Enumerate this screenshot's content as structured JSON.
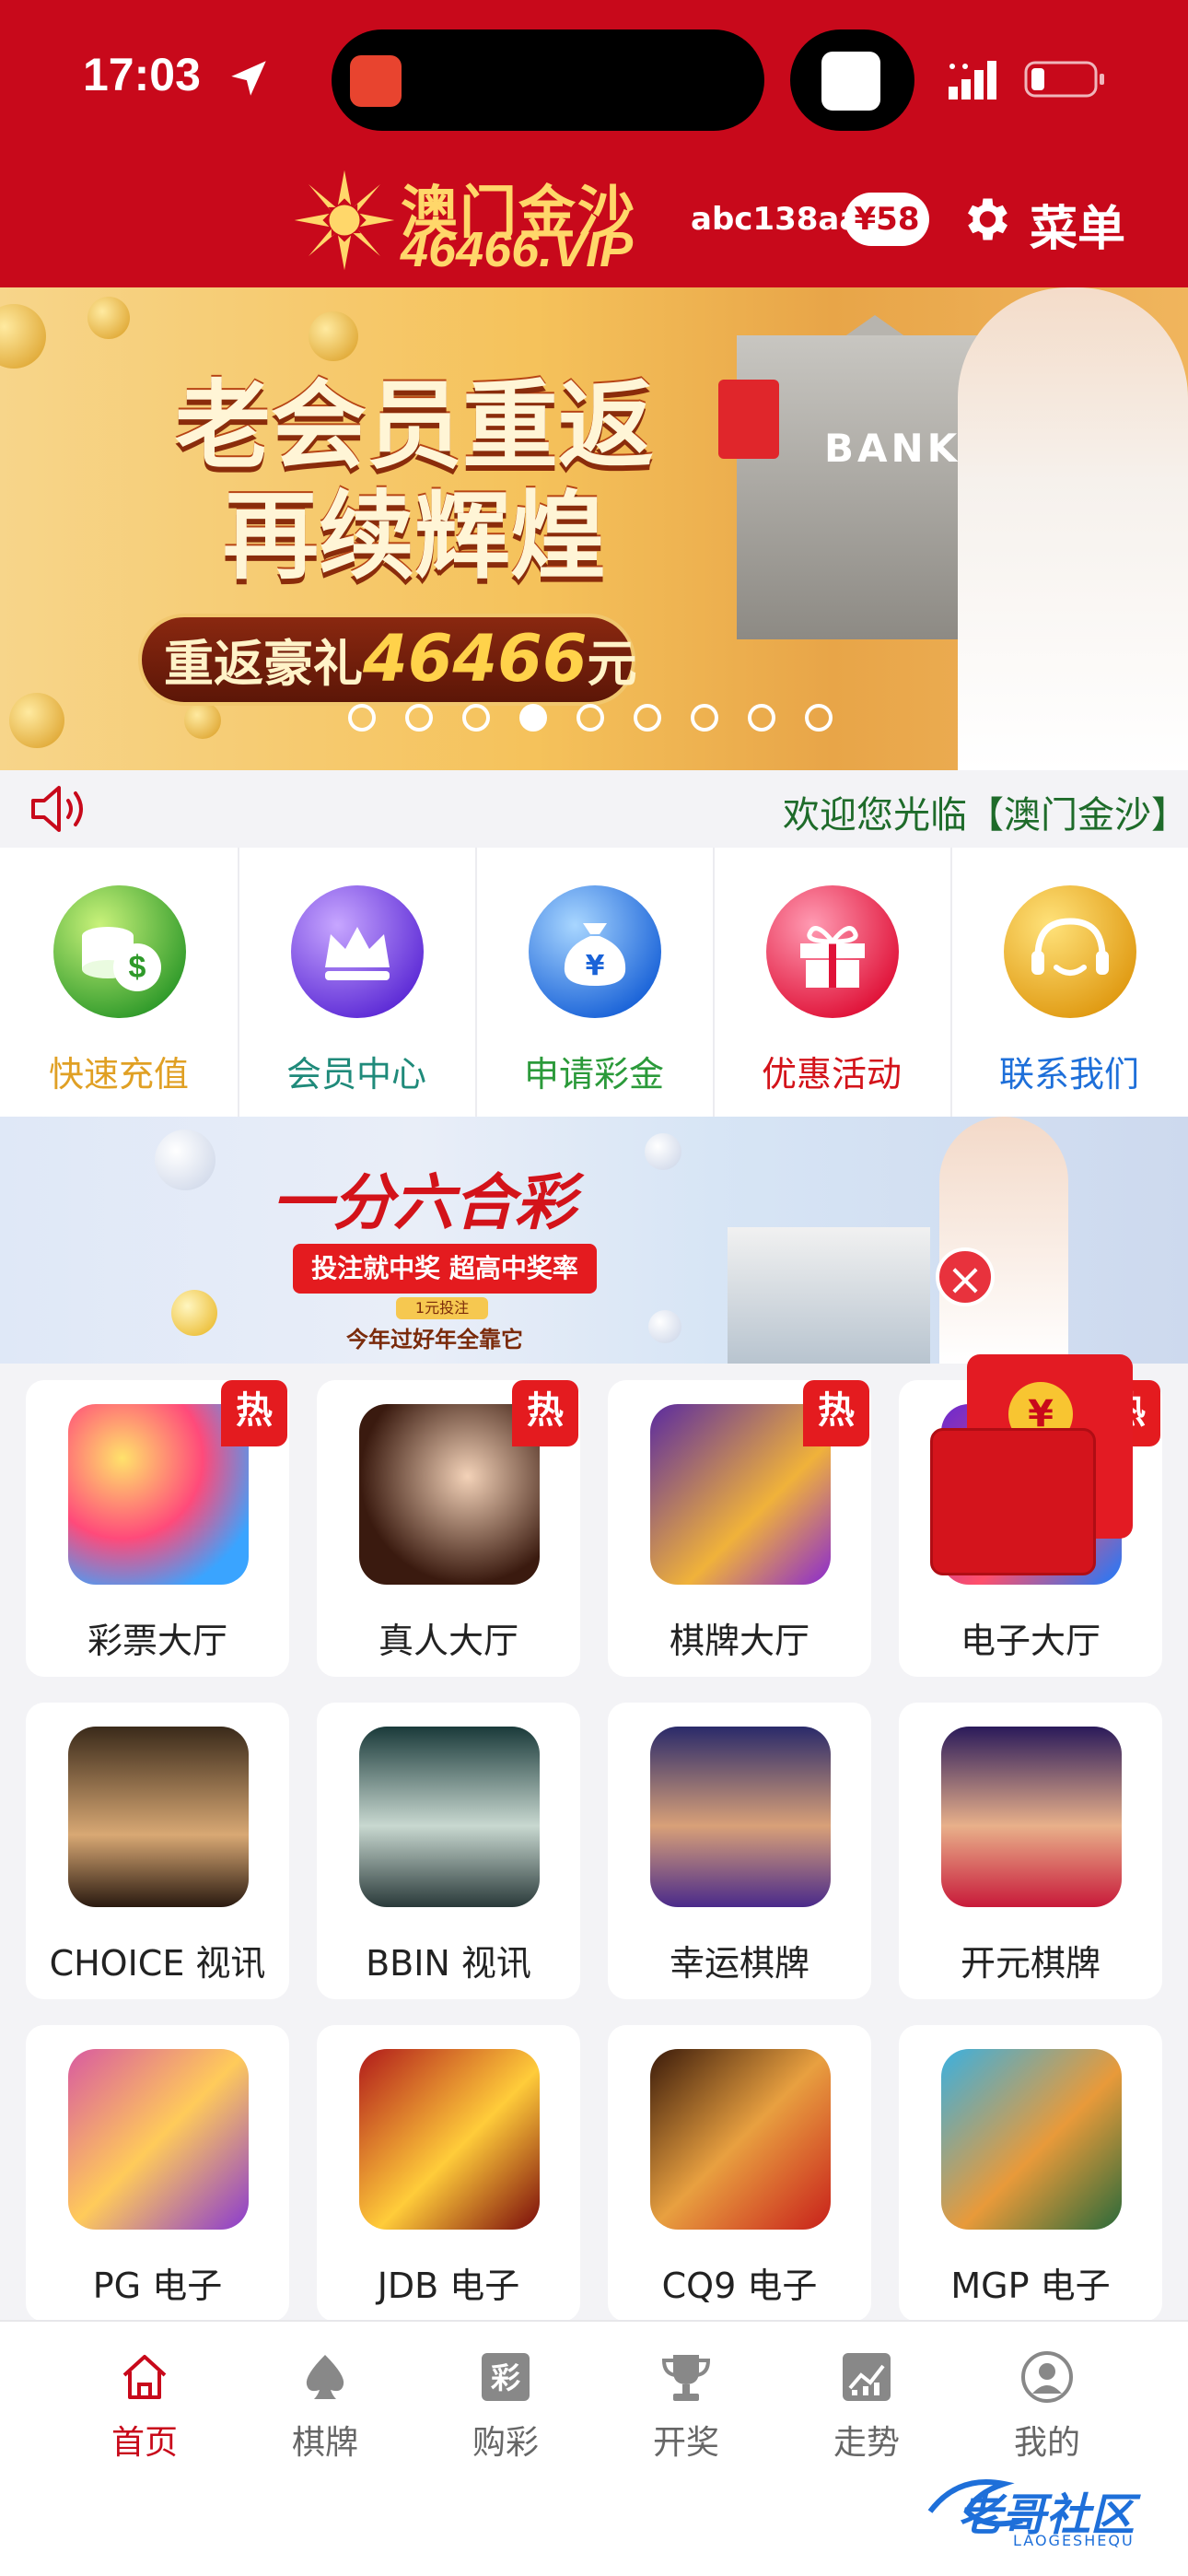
{
  "status_bar": {
    "time": "17:03"
  },
  "header": {
    "logo_cn": "澳门金沙",
    "logo_en": "46466.VIP",
    "username": "abc138aa",
    "balance": "¥58",
    "menu_label": "菜单",
    "color": "#c8091b"
  },
  "hero": {
    "title_line1": "老会员重返",
    "title_line2": "再续辉煌",
    "sub_prefix": "重返豪礼",
    "sub_number": "46466",
    "sub_suffix": "元",
    "bank_label": "BANK",
    "dot_count": 9,
    "active_dot": 3
  },
  "notice": {
    "text": "欢迎您光临【澳门金沙】"
  },
  "quick_actions": [
    {
      "label": "快速充值",
      "icon": "money-stack-icon",
      "color": "#e0a024"
    },
    {
      "label": "会员中心",
      "icon": "crown-icon",
      "color": "#1f8a7a"
    },
    {
      "label": "申请彩金",
      "icon": "money-bag-icon",
      "color": "#2b9a3a"
    },
    {
      "label": "优惠活动",
      "icon": "gift-icon",
      "color": "#d3131a"
    },
    {
      "label": "联系我们",
      "icon": "support-icon",
      "color": "#1e6fd9"
    }
  ],
  "promo": {
    "title": "一分六合彩",
    "ribbon": "投注就中奖 超高中奖率",
    "small": "1元投注",
    "footer": "今年过好年全靠它"
  },
  "games": [
    {
      "label": "彩票大厅",
      "hot": "热",
      "icon": "lottery-balls-icon"
    },
    {
      "label": "真人大厅",
      "hot": "热",
      "icon": "live-dealer-icon"
    },
    {
      "label": "棋牌大厅",
      "hot": "热",
      "icon": "cards-icon"
    },
    {
      "label": "电子大厅",
      "hot": "热",
      "icon": "slots-icon"
    },
    {
      "label": "CHOICE 视讯",
      "hot": "",
      "icon": "choice-dealer-icon"
    },
    {
      "label": "BBIN 视讯",
      "hot": "",
      "icon": "bbin-dealer-icon"
    },
    {
      "label": "幸运棋牌",
      "hot": "",
      "icon": "lucky-cards-icon"
    },
    {
      "label": "开元棋牌",
      "hot": "",
      "icon": "kaiyuan-cards-icon"
    },
    {
      "label": "PG 电子",
      "hot": "",
      "icon": "pg-slot-icon"
    },
    {
      "label": "JDB 电子",
      "hot": "",
      "icon": "jdb-slot-icon"
    },
    {
      "label": "CQ9 电子",
      "hot": "",
      "icon": "cq9-slot-icon"
    },
    {
      "label": "MGP 电子",
      "hot": "",
      "icon": "mgp-slot-icon"
    }
  ],
  "red_packet": {
    "symbol": "¥"
  },
  "tabbar": [
    {
      "label": "首页",
      "icon": "home-icon",
      "active": true
    },
    {
      "label": "棋牌",
      "icon": "spade-icon",
      "active": false
    },
    {
      "label": "购彩",
      "icon": "lottery-ticket-icon",
      "active": false
    },
    {
      "label": "开奖",
      "icon": "trophy-icon",
      "active": false
    },
    {
      "label": "走势",
      "icon": "trend-chart-icon",
      "active": false
    },
    {
      "label": "我的",
      "icon": "user-icon",
      "active": false
    }
  ],
  "watermark": {
    "text": "老哥社区",
    "sub": "LAOGESHEQU"
  }
}
